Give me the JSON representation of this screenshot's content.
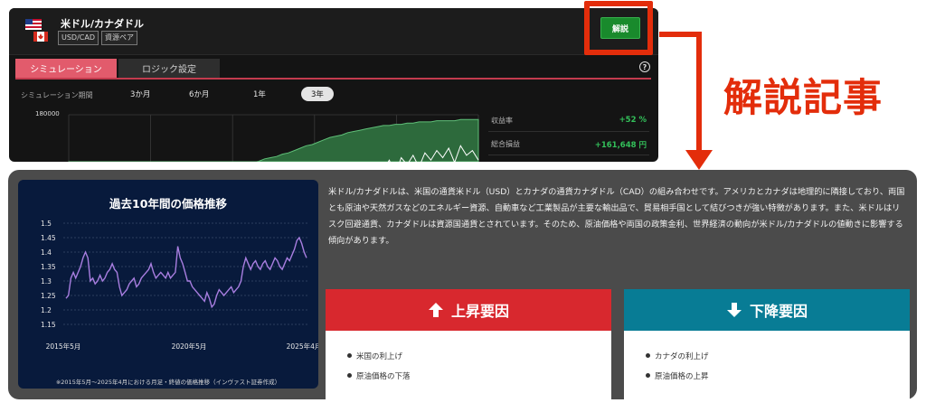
{
  "app": {
    "pair_name": "米ドル/カナダドル",
    "tags": [
      "USD/CAD",
      "資源ペア"
    ],
    "kaisetsu_label": "解説",
    "tabs": [
      "シミュレーション",
      "ロジック設定"
    ],
    "help_glyph": "?",
    "period_label": "シミュレーション期間",
    "periods": [
      "3か月",
      "6か月",
      "1年",
      "3年"
    ],
    "selected_period": "3年",
    "sim_chart_top_label": "180000",
    "stats": [
      {
        "label": "収益率",
        "value": "+52 %"
      },
      {
        "label": "総合損益",
        "value": "+161,648 円"
      }
    ]
  },
  "callout": {
    "title": "解説記事",
    "color": "#e32d0b"
  },
  "article": {
    "chart": {
      "title": "過去10年間の価格推移",
      "note": "※2015年5月〜2025年4月における月足・終値の価格推移（インヴァスト証券作成）"
    },
    "description": "米ドル/カナダドルは、米国の通貨米ドル（USD）とカナダの通貨カナダドル（CAD）の組み合わせです。アメリカとカナダは地理的に隣接しており、両国とも原油や天然ガスなどのエネルギー資源、自動車など工業製品が主要な輸出品で、貿易相手国として結びつきが強い特徴があります。また、米ドルはリスク回避通貨、カナダドルは資源国通貨とされています。そのため、原油価格や両国の政策金利、世界経済の動向が米ドル/カナダドルの値動きに影響する傾向があります。",
    "factors": {
      "up": {
        "title": "上昇要因",
        "items": [
          "米国の利上げ",
          "原油価格の下落"
        ],
        "color": "#d8282e"
      },
      "down": {
        "title": "下降要因",
        "items": [
          "カナダの利上げ",
          "原油価格の上昇"
        ],
        "color": "#087c95"
      }
    }
  },
  "chart_data": {
    "type": "line",
    "title": "過去10年間の価格推移",
    "xlabel": "",
    "ylabel": "",
    "x_tick_labels": [
      "2015年5月",
      "2020年5月",
      "2025年4月"
    ],
    "y_ticks": [
      1.15,
      1.2,
      1.25,
      1.3,
      1.35,
      1.4,
      1.45,
      1.5
    ],
    "ylim": [
      1.15,
      1.5
    ],
    "grid": true,
    "series": [
      {
        "name": "",
        "color": "#a87ee0",
        "values": [
          1.24,
          1.25,
          1.31,
          1.33,
          1.31,
          1.33,
          1.35,
          1.38,
          1.4,
          1.38,
          1.3,
          1.31,
          1.29,
          1.3,
          1.32,
          1.3,
          1.31,
          1.33,
          1.34,
          1.36,
          1.34,
          1.33,
          1.28,
          1.25,
          1.26,
          1.27,
          1.29,
          1.3,
          1.31,
          1.28,
          1.29,
          1.31,
          1.32,
          1.33,
          1.34,
          1.36,
          1.33,
          1.31,
          1.32,
          1.33,
          1.32,
          1.31,
          1.33,
          1.31,
          1.32,
          1.33,
          1.42,
          1.38,
          1.36,
          1.33,
          1.3,
          1.3,
          1.28,
          1.27,
          1.26,
          1.25,
          1.24,
          1.23,
          1.26,
          1.24,
          1.21,
          1.22,
          1.25,
          1.27,
          1.26,
          1.25,
          1.26,
          1.27,
          1.28,
          1.26,
          1.27,
          1.28,
          1.3,
          1.35,
          1.38,
          1.36,
          1.34,
          1.36,
          1.37,
          1.35,
          1.34,
          1.36,
          1.37,
          1.35,
          1.34,
          1.36,
          1.38,
          1.37,
          1.35,
          1.34,
          1.36,
          1.38,
          1.37,
          1.39,
          1.41,
          1.44,
          1.45,
          1.43,
          1.4,
          1.38
        ]
      }
    ]
  },
  "sim_chart_data": {
    "type": "area",
    "ylim": [
      0,
      180000
    ],
    "series": [
      {
        "name": "",
        "values": [
          22,
          23,
          22,
          24,
          25,
          27,
          28,
          27,
          29,
          31,
          32,
          33,
          34,
          35,
          37,
          38,
          39,
          40,
          42,
          43,
          45,
          46,
          47,
          48,
          50,
          51,
          53,
          54,
          55,
          56,
          58,
          60,
          61,
          63,
          64,
          65,
          67,
          68,
          70,
          72,
          74,
          75,
          77,
          79,
          81,
          82,
          83,
          85,
          86,
          87,
          88,
          89,
          90,
          91,
          91,
          92,
          92,
          93,
          93,
          94,
          94,
          94,
          95,
          95,
          95,
          95,
          96,
          96,
          96,
          96
        ]
      },
      {
        "name": "",
        "values": [
          5,
          8,
          4,
          10,
          6,
          12,
          9,
          7,
          11,
          6,
          8,
          14,
          9,
          16,
          12,
          10,
          20,
          15,
          12,
          22,
          18,
          14,
          25,
          20,
          17,
          28,
          22,
          30,
          26,
          32,
          28,
          25,
          35,
          30,
          38,
          34,
          30,
          40,
          42,
          38,
          45,
          40,
          48,
          44,
          50,
          46,
          52,
          48,
          55,
          45,
          58,
          52,
          60,
          54,
          62,
          50,
          64,
          58,
          66,
          56,
          68,
          62,
          70,
          64,
          72,
          60,
          74,
          66,
          70,
          62
        ]
      }
    ]
  }
}
